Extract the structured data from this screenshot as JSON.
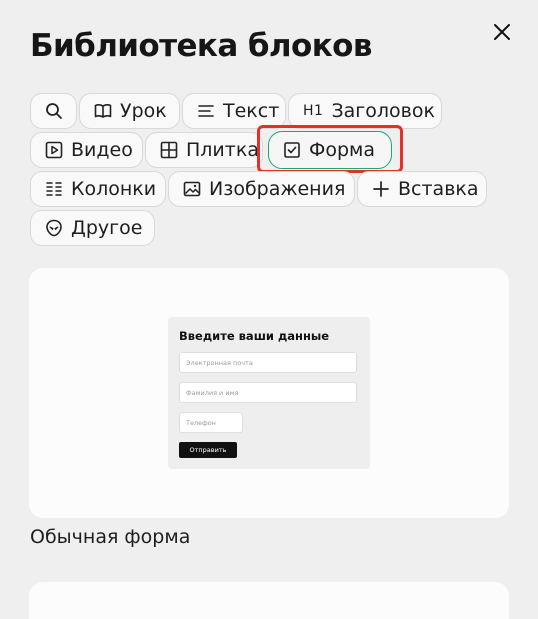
{
  "header": {
    "title": "Библиотека блоков"
  },
  "filters": {
    "search_icon": "search-icon",
    "items": [
      {
        "label": "Урок",
        "icon": "book-icon"
      },
      {
        "label": "Текст",
        "icon": "text-lines-icon"
      },
      {
        "label": "Заголовок",
        "icon_text": "H1"
      },
      {
        "label": "Видео",
        "icon": "video-icon"
      },
      {
        "label": "Плитка",
        "icon": "grid-icon"
      },
      {
        "label": "Форма",
        "icon": "checkbox-icon",
        "active": true
      },
      {
        "label": "Колонки",
        "icon": "columns-icon"
      },
      {
        "label": "Изображения",
        "icon": "image-icon"
      },
      {
        "label": "Вставка",
        "icon": "plus-icon"
      },
      {
        "label": "Другое",
        "icon": "alien-icon"
      }
    ]
  },
  "cards": [
    {
      "caption": "Обычная форма",
      "preview": {
        "title": "Введите ваши данные",
        "fields": [
          "Электронная почта",
          "Фамилия и имя",
          "Телефон"
        ],
        "button": "Отправить"
      }
    }
  ],
  "colors": {
    "active_border": "#1fa672",
    "highlight": "#e0312d",
    "background": "#efefef"
  }
}
